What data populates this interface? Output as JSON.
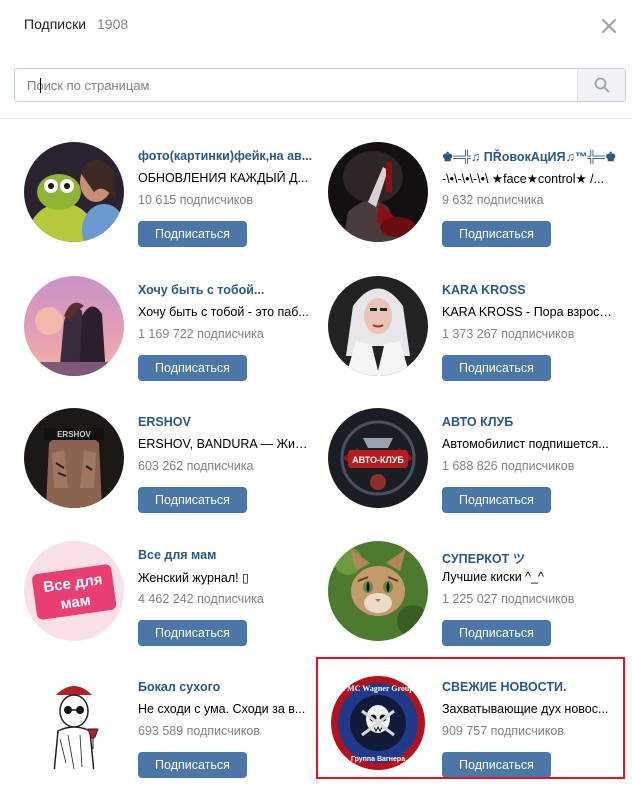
{
  "header": {
    "title": "Подписки",
    "count": "1908"
  },
  "search": {
    "placeholder": "Поиск по страницам",
    "value": ""
  },
  "groups": [
    {
      "name": "фото(картинки)фейк,на ав...",
      "description": "ОБНОВЛЕНИЯ КАЖДЫЙ Д...",
      "subscribers": "10 615 подписчиков",
      "button": "Подписаться"
    },
    {
      "name": "♚═╬♫ ПŘовокАцИЯ♫™╬═♚",
      "description": "-\\•\\-\\•\\-\\•\\ ★face★control★ /...",
      "subscribers": "9 632 подписчика",
      "button": "Подписаться"
    },
    {
      "name": "Хочу быть с тобой...",
      "description": "Хочу быть с тобой - это паб...",
      "subscribers": "1 169 722 подписчика",
      "button": "Подписаться"
    },
    {
      "name": "KARA KROSS",
      "description": "KARA KROSS - Пора взросл...",
      "subscribers": "1 373 267 подписчиков",
      "button": "Подписаться"
    },
    {
      "name": "ERSHOV",
      "description": "ERSHOV, BANDURA — Жить ...",
      "subscribers": "603 262 подписчика",
      "button": "Подписаться"
    },
    {
      "name": "АВТО КЛУБ",
      "description": "Автомобилист подпишется...",
      "subscribers": "1 688 826 подписчиков",
      "button": "Подписаться"
    },
    {
      "name": "Все для мам",
      "description": "Женский журнал! ▯",
      "subscribers": "4 462 242 подписчика",
      "button": "Подписаться"
    },
    {
      "name": "СУПЕРКОТ ツ",
      "description": "Лучшие киски ^_^",
      "subscribers": "1 225 027 подписчиков",
      "button": "Подписаться"
    },
    {
      "name": "Бокал сухого",
      "description": "Не сходи с ума. Сходи за в...",
      "subscribers": "693 589 подписчиков",
      "button": "Подписаться"
    },
    {
      "name": "СВЕЖИЕ НОВОСТИ.",
      "description": "Захватывающие дух новос...",
      "subscribers": "909 757 подписчиков",
      "button": "Подписаться"
    }
  ],
  "avatars": {
    "ershov_banner": "ERSHOV",
    "avto_logo": "АВТО-КЛУБ",
    "mom_logo_line1": "Все для",
    "mom_logo_line2": "мам",
    "wagner_top": "PMC Wagner Group",
    "wagner_bottom": "Группа Вагнера"
  },
  "colors": {
    "link": "#2a5885",
    "button": "#4a76a8",
    "highlight": "#e0141e"
  }
}
